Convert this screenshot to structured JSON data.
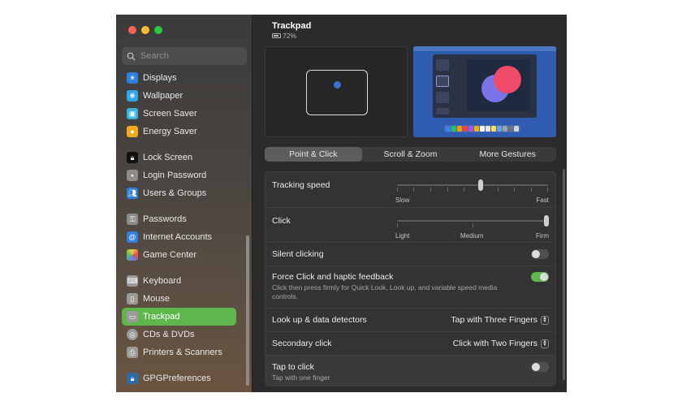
{
  "window": {
    "traffic_lights": [
      "close",
      "minimize",
      "maximize"
    ],
    "colors": {
      "close": "#fe5f57",
      "minimize": "#febc2e",
      "maximize": "#28c840",
      "accent": "#5fb64c"
    }
  },
  "sidebar": {
    "search_placeholder": "Search",
    "items": [
      {
        "label": "Displays",
        "icon": "displays-icon"
      },
      {
        "label": "Wallpaper",
        "icon": "wallpaper-icon"
      },
      {
        "label": "Screen Saver",
        "icon": "screen-saver-icon"
      },
      {
        "label": "Energy Saver",
        "icon": "energy-saver-icon"
      },
      {
        "label": "Lock Screen",
        "icon": "lock-screen-icon"
      },
      {
        "label": "Login Password",
        "icon": "login-password-icon"
      },
      {
        "label": "Users & Groups",
        "icon": "users-groups-icon"
      },
      {
        "label": "Passwords",
        "icon": "passwords-icon"
      },
      {
        "label": "Internet Accounts",
        "icon": "internet-accounts-icon"
      },
      {
        "label": "Game Center",
        "icon": "game-center-icon"
      },
      {
        "label": "Keyboard",
        "icon": "keyboard-icon"
      },
      {
        "label": "Mouse",
        "icon": "mouse-icon"
      },
      {
        "label": "Trackpad",
        "icon": "trackpad-icon",
        "selected": true
      },
      {
        "label": "CDs & DVDs",
        "icon": "cds-dvds-icon"
      },
      {
        "label": "Printers & Scanners",
        "icon": "printers-scanners-icon"
      },
      {
        "label": "GPGPreferences",
        "icon": "gpg-icon"
      }
    ]
  },
  "header": {
    "title": "Trackpad",
    "battery": "72%"
  },
  "tabs": [
    {
      "label": "Point & Click",
      "active": true
    },
    {
      "label": "Scroll & Zoom",
      "active": false
    },
    {
      "label": "More Gestures",
      "active": false
    }
  ],
  "settings": {
    "tracking_speed": {
      "label": "Tracking speed",
      "min_label": "Slow",
      "max_label": "Fast",
      "value_fraction": 0.7
    },
    "click": {
      "label": "Click",
      "labels": [
        "Light",
        "Medium",
        "Firm"
      ],
      "value_fraction": 1.0
    },
    "silent_clicking": {
      "label": "Silent clicking",
      "on": false
    },
    "force_click": {
      "label": "Force Click and haptic feedback",
      "description": "Click then press firmly for Quick Look, Look up, and variable speed media controls.",
      "on": true
    },
    "look_up": {
      "label": "Look up & data detectors",
      "value": "Tap with Three Fingers"
    },
    "secondary_click": {
      "label": "Secondary click",
      "value": "Click with Two Fingers"
    },
    "tap_to_click": {
      "label": "Tap to click",
      "description": "Tap with one finger",
      "on": false
    }
  }
}
